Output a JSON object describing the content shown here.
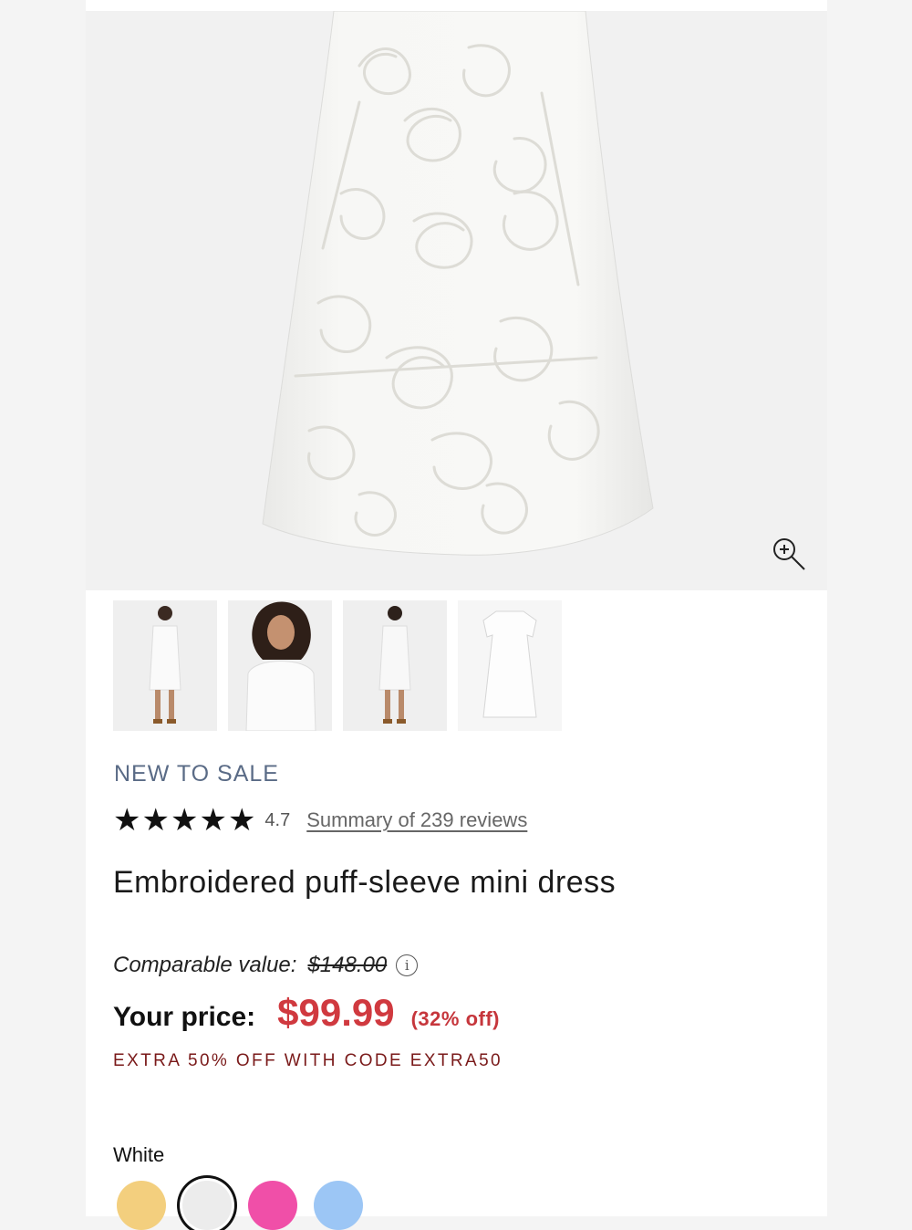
{
  "product": {
    "badge": "NEW TO SALE",
    "rating": "4.7",
    "rating_stars": 4.7,
    "reviews_link": "Summary of 239 reviews",
    "title": "Embroidered puff-sleeve mini dress",
    "comparable_label": "Comparable value:",
    "comparable_price": "$148.00",
    "price_label": "Your price:",
    "price": "$99.99",
    "discount": "(32% off)",
    "promo": "EXTRA 50% OFF WITH CODE EXTRA50",
    "color_label": "White"
  },
  "gallery": {
    "thumbnails": [
      {
        "name": "model-front-full"
      },
      {
        "name": "model-closeup"
      },
      {
        "name": "model-back-full"
      },
      {
        "name": "product-flat"
      }
    ],
    "selected_index": 3
  },
  "swatches": [
    {
      "name": "yellow",
      "color": "#f3cf7e"
    },
    {
      "name": "white",
      "color": "#ececec",
      "selected": true
    },
    {
      "name": "pink",
      "color": "#f04fa8"
    },
    {
      "name": "blue",
      "color": "#9cc6f5"
    }
  ],
  "icons": {
    "zoom": "zoom-in-icon",
    "info": "info-icon",
    "star": "star-icon"
  }
}
